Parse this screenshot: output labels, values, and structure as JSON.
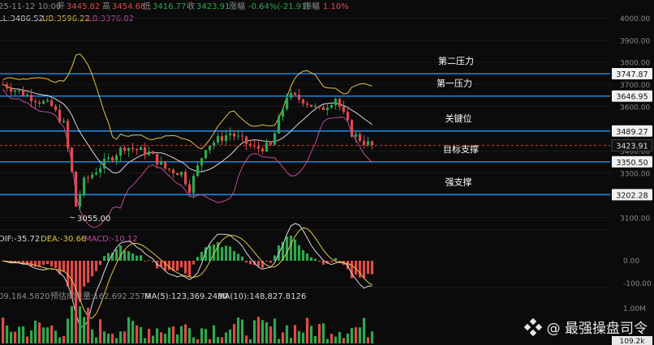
{
  "header": {
    "date": "25-11-12 10:00",
    "open_label": "开",
    "open": "3445.82",
    "high_label": "高",
    "high": "3454.68",
    "low_label": "低",
    "low": "3416.77",
    "close_label": "收",
    "close": "3423.91",
    "change_label": "涨幅",
    "change": "-0.64%(-21.91)",
    "amp_label": "振幅",
    "amp": "1.10%"
  },
  "boll": {
    "ll": "LL:3486.52",
    "ub": "UB:3596.22",
    "lb": "LB:3376.82"
  },
  "macd": {
    "dif": "DIF:-35.72",
    "dea": "DEA:-30.66",
    "macd": "MACD:-10.12"
  },
  "volume": {
    "vol": "09,184.5820",
    "est": "预估成交量:162,692.2579",
    "ma5": "MA(5):123,369.2430",
    "ma10": "MA(10):148,827.8126"
  },
  "colors": {
    "up": "#2fa84f",
    "down": "#e14a4a",
    "level": "#1e88e5",
    "price_tag": "#d33",
    "ma_yellow": "#e2c54a",
    "ma_white": "#d9d9d9",
    "ma_purple": "#c04aa0"
  },
  "chart_data": {
    "type": "candlestick",
    "ylim": [
      3050,
      4000
    ],
    "y_ticks": [
      "4000.00",
      "3900.00",
      "3800.00",
      "3700.00",
      "3600.00",
      "3500.00",
      "3400.00",
      "3300.00",
      "3200.00",
      "3100.00"
    ],
    "levels": [
      {
        "name": "第二压力",
        "value": "3747.87"
      },
      {
        "name": "第一压力",
        "value": "3646.95"
      },
      {
        "name": "关键位",
        "value": "3489.27"
      },
      {
        "name": "目标支撑",
        "value": "3350.50"
      },
      {
        "name": "强支撑",
        "value": "3202.28"
      }
    ],
    "current_price": "3423.91",
    "low_annotation": "3055.00",
    "macd_ticks": [
      "0.00",
      "-100.00"
    ],
    "volume_ticks": [
      "1.00M",
      "109.2k"
    ]
  }
}
